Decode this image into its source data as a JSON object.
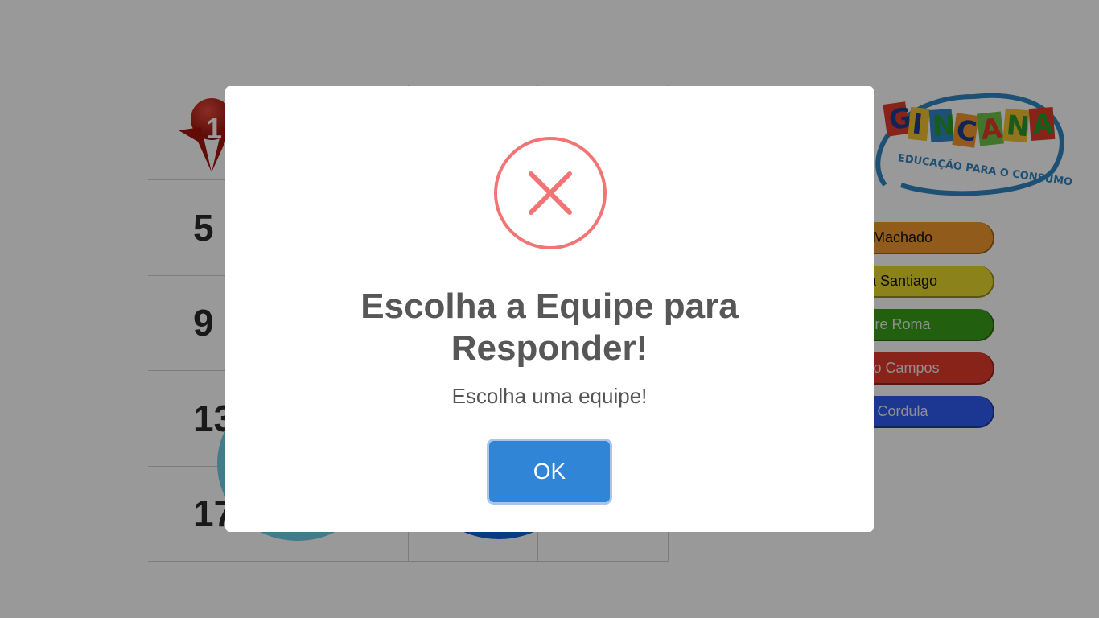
{
  "board": {
    "cells": [
      "1",
      "5",
      "9",
      "13",
      "17"
    ]
  },
  "logo": {
    "text": "GINCANA",
    "subtitle": "EDUCAÇÃO PARA O CONSUMO"
  },
  "teams": [
    {
      "label": "Machado",
      "color": "#f29a2e"
    },
    {
      "label": "a Santiago",
      "color": "#e9d92e"
    },
    {
      "label": "re Roma",
      "color": "#3aa11a"
    },
    {
      "label": "co Campos",
      "color": "#e33b2c"
    },
    {
      "label": "Cordula",
      "color": "#2f5cf2"
    }
  ],
  "modal": {
    "icon": "error-x-icon",
    "title_line1": "Escolha a Equipe para",
    "title_line2": "Responder!",
    "text": "Escolha uma equipe!",
    "ok_label": "OK",
    "icon_color": "#f27474",
    "button_color": "#3085d6"
  }
}
